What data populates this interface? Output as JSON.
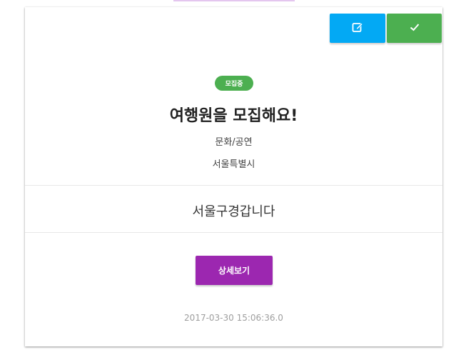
{
  "card": {
    "status_badge": "모집중",
    "title": "여행원을 모집해요!",
    "category": "문화/공연",
    "region": "서울특별시",
    "description": "서울구경갑니다",
    "detail_button_label": "상세보기",
    "timestamp": "2017-03-30 15:06:36.0"
  },
  "actions": {
    "edit_icon": "edit-icon",
    "confirm_icon": "check-icon"
  },
  "colors": {
    "edit": "#03a9f4",
    "confirm": "#4caf50",
    "badge": "#4caf50",
    "detail": "#9c27b0"
  }
}
